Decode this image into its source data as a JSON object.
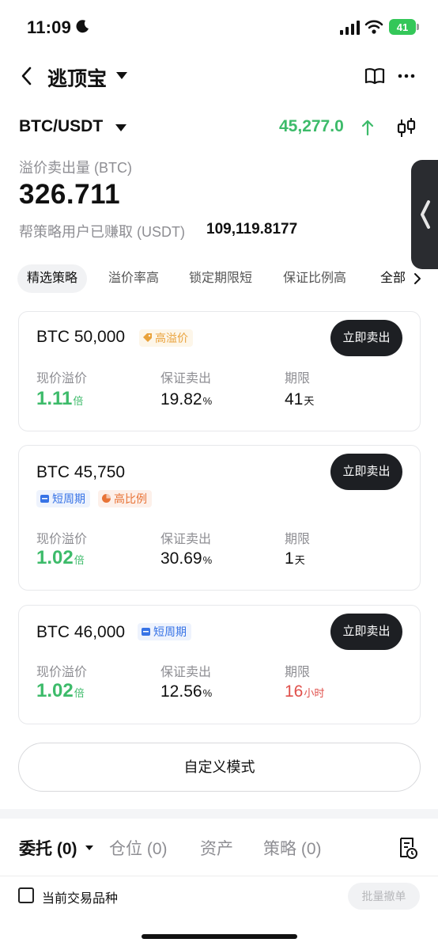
{
  "status_bar": {
    "time": "11:09",
    "battery": "41"
  },
  "header": {
    "title": "逃顶宝"
  },
  "pair": {
    "name": "BTC/USDT",
    "price": "45,277.0"
  },
  "metrics": {
    "label": "溢价卖出量 (BTC)",
    "value": "326.711",
    "earned_label": "帮策略用户已赚取 (USDT)",
    "earned_value": "109,119.8177"
  },
  "filters": [
    "精选策略",
    "溢价率高",
    "锁定期限短",
    "保证比例高",
    "全部"
  ],
  "cards": [
    {
      "title": "BTC 50,000",
      "tags": [
        "高溢价"
      ],
      "button": "立即卖出",
      "col1_label": "现价溢价",
      "col1_value": "1.11",
      "col1_unit": "倍",
      "col2_label": "保证卖出",
      "col2_value": "19.82",
      "col2_unit": "%",
      "col3_label": "期限",
      "col3_value": "41",
      "col3_unit": "天"
    },
    {
      "title": "BTC 45,750",
      "tags": [
        "短周期",
        "高比例"
      ],
      "button": "立即卖出",
      "col1_label": "现价溢价",
      "col1_value": "1.02",
      "col1_unit": "倍",
      "col2_label": "保证卖出",
      "col2_value": "30.69",
      "col2_unit": "%",
      "col3_label": "期限",
      "col3_value": "1",
      "col3_unit": "天"
    },
    {
      "title": "BTC 46,000",
      "tags": [
        "短周期"
      ],
      "button": "立即卖出",
      "col1_label": "现价溢价",
      "col1_value": "1.02",
      "col1_unit": "倍",
      "col2_label": "保证卖出",
      "col2_value": "12.56",
      "col2_unit": "%",
      "col3_label": "期限",
      "col3_value": "16",
      "col3_unit": "小时"
    }
  ],
  "custom_button": "自定义模式",
  "bottom_tabs": [
    "委托 (0)",
    "仓位 (0)",
    "资产",
    "策略 (0)"
  ],
  "filter_current": "当前交易品种",
  "batch_cancel": "批量撤单",
  "colors": {
    "green": "#3dbb6a",
    "red": "#e0504b",
    "dark_button": "#1d1f23"
  }
}
